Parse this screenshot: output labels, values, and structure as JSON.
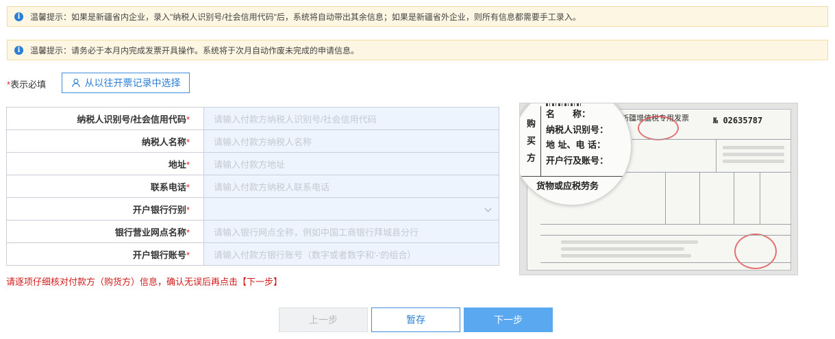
{
  "notices": [
    {
      "text": "温馨提示：如果是新疆省内企业，录入\"纳税人识别号/社会信用代码\"后，系统将自动带出其余信息；如果是新疆省外企业，则所有信息都需要手工录入。"
    },
    {
      "text": "温馨提示：请务必于本月内完成发票开具操作。系统将于次月自动作废未完成的申请信息。"
    }
  ],
  "required_note": {
    "star": "*",
    "text": "表示必填"
  },
  "history_button": {
    "label": "从以往开票记录中选择",
    "icon": "user-icon"
  },
  "form": {
    "rows": [
      {
        "label": "纳税人识别号/社会信用代码",
        "placeholder": "请输入付款方纳税人识别号/社会信用代码"
      },
      {
        "label": "纳税人名称",
        "placeholder": "请输入付款方纳税人名称"
      },
      {
        "label": "地址",
        "placeholder": "请输入付款方地址"
      },
      {
        "label": "联系电话",
        "placeholder": "请输入付款方纳税人联系电话"
      },
      {
        "label": "开户银行行别",
        "placeholder": "",
        "select": true
      },
      {
        "label": "银行营业网点名称",
        "placeholder": "请输入银行网点全称，例如中国工商银行拜城县分行"
      },
      {
        "label": "开户银行账号",
        "placeholder": "请输入付款方银行账号（数字或者数字和'-'的组合）"
      }
    ],
    "required_mark": "*"
  },
  "warning": "请逐项仔细核对付款方（购货方）信息，确认无误后再点击【下一步】",
  "buttons": {
    "prev": "上一步",
    "save": "暂存",
    "next": "下一步"
  },
  "invoice": {
    "title": "新疆增值税专用发票",
    "number": "№ 02635787",
    "buyer": "购买方",
    "fields": [
      "名　　称：",
      "纳税人识别号：",
      "地 址、电 话：",
      "开户行及账号："
    ],
    "goods": "货物或应税劳务"
  },
  "colors": {
    "accent": "#2a7fd4",
    "required": "#e02020",
    "notice_bg": "#fdf6e3",
    "input_bg": "#eef4fd",
    "next_bg": "#5aa8f0"
  }
}
